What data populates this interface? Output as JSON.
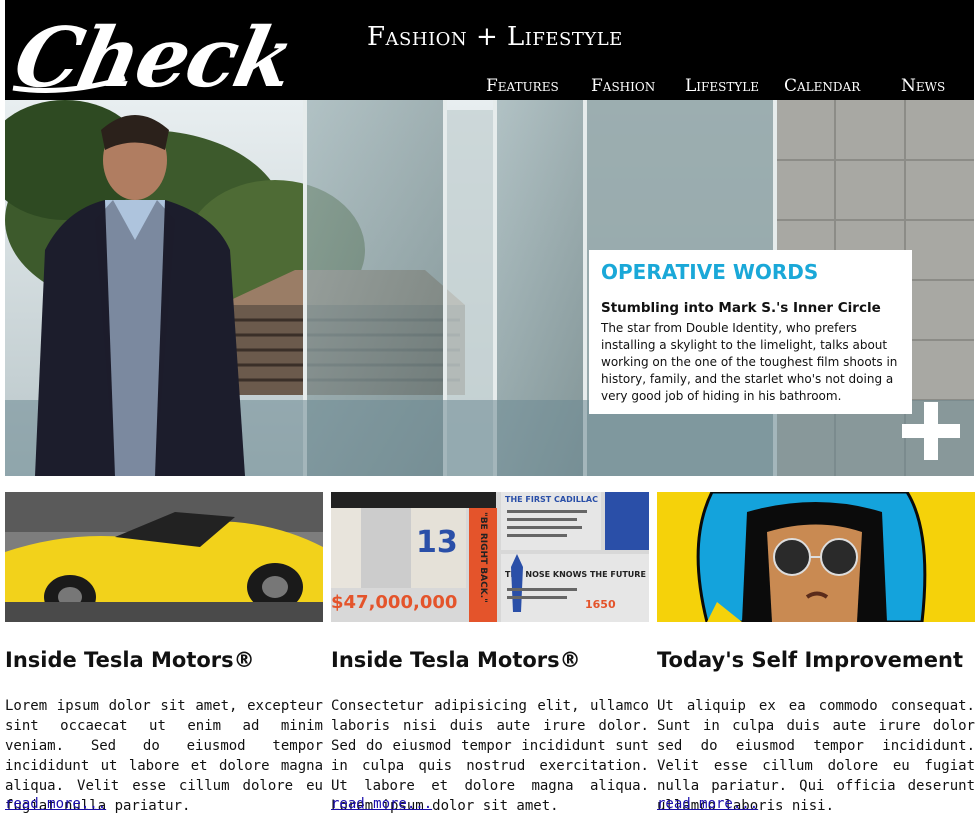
{
  "header": {
    "logo_text": "Check",
    "tagline": "Fashion + Lifestyle",
    "nav": [
      {
        "label": "Features"
      },
      {
        "label": "Fashion"
      },
      {
        "label": "Lifestyle"
      },
      {
        "label": "Calendar"
      },
      {
        "label": "News"
      }
    ]
  },
  "hero": {
    "kicker": "OPERATIVE WORDS",
    "title": "Stumbling into Mark S.'s Inner Circle",
    "body": "The star from Double Identity, who prefers installing a skylight to the limelight, talks about working on the one of the toughest film shoots in history, family, and the starlet who's not doing a very good job of hiding in his bathroom."
  },
  "cards": [
    {
      "title": "Inside Tesla Motors®",
      "text": "Lorem ipsum dolor sit amet, excepteur sint occaecat ut enim ad minim veniam. Sed do eiusmod tempor incididunt ut labore et dolore magna aliqua. Velit esse cillum dolore eu fugiat nulla pariatur.",
      "more": "read more..."
    },
    {
      "title": "Inside Tesla Motors®",
      "text": "Consectetur adipisicing elit, ullamco laboris nisi duis aute irure dolor. Sed do eiusmod tempor incididunt sunt in culpa quis nostrud exercitation. Ut labore et dolore magna aliqua. Lorem ipsum dolor sit amet.",
      "more": "read more...",
      "image_text": {
        "headline1": "THE FIRST CADILLAC",
        "headline2": "THE NOSE KNOWS THE FUTURE",
        "big_number": "13",
        "quote": "\"BE RIGHT BACK.\"",
        "price": "$47,000,000",
        "year": "1650"
      }
    },
    {
      "title": "Today's Self Improvement",
      "text": "Ut aliquip ex ea commodo consequat. Sunt in culpa duis aute irure dolor sed do eiusmod tempor incididunt. Velit esse cillum dolore eu fugiat nulla pariatur. Qui officia deserunt ullamco laboris nisi.",
      "more": "read more..."
    }
  ]
}
